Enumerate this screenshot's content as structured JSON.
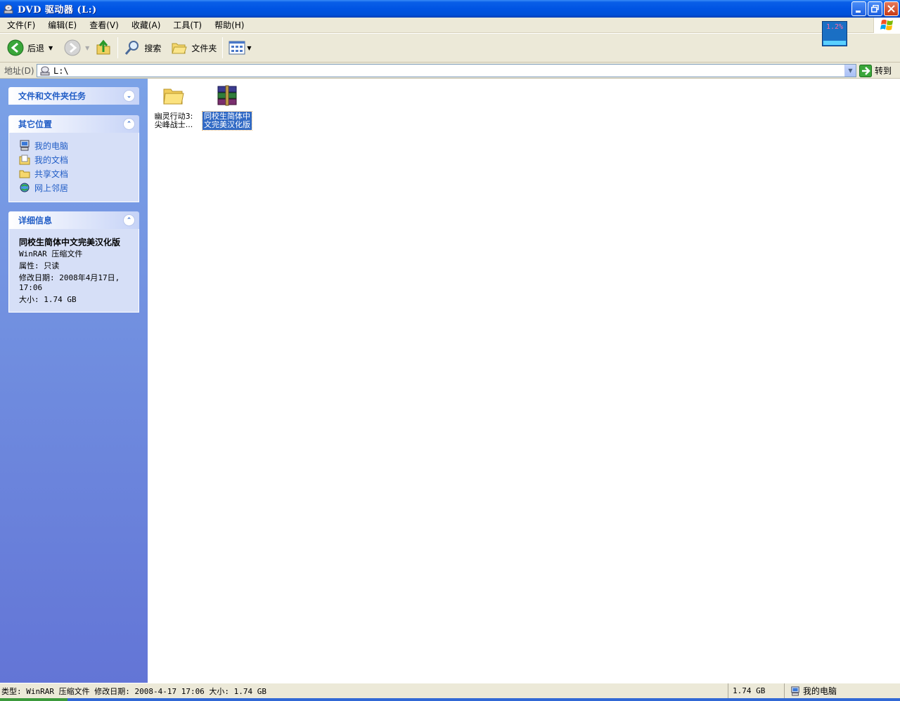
{
  "window": {
    "title": "DVD 驱动器 (L:)",
    "icons": {
      "app": "dvd-drive-icon"
    }
  },
  "menu": {
    "items": [
      {
        "label": "文件(F)"
      },
      {
        "label": "编辑(E)"
      },
      {
        "label": "查看(V)"
      },
      {
        "label": "收藏(A)"
      },
      {
        "label": "工具(T)"
      },
      {
        "label": "帮助(H)"
      }
    ],
    "cpu_widget": "1.2%"
  },
  "toolbar": {
    "back_label": "后退",
    "search_label": "搜索",
    "folders_label": "文件夹"
  },
  "address": {
    "label": "地址(D)",
    "value": "L:\\",
    "go_label": "转到"
  },
  "sidebar": {
    "tasks_title": "文件和文件夹任务",
    "places_title": "其它位置",
    "places": [
      {
        "label": "我的电脑",
        "icon": "my-computer-icon"
      },
      {
        "label": "我的文档",
        "icon": "my-documents-icon"
      },
      {
        "label": "共享文档",
        "icon": "shared-documents-icon"
      },
      {
        "label": "网上邻居",
        "icon": "network-places-icon"
      }
    ],
    "details_title": "详细信息",
    "details": {
      "name": "同校生简体中文完美汉化版",
      "type": "WinRAR 压缩文件",
      "attributes": "属性: 只读",
      "modified": "修改日期: 2008年4月17日, 17:06",
      "size": "大小: 1.74 GB"
    }
  },
  "files": [
    {
      "name": "幽灵行动3: 尖峰战士...",
      "icon": "folder-icon",
      "selected": false
    },
    {
      "name": "同校生简体中文完美汉化版",
      "icon": "winrar-archive-icon",
      "selected": true
    }
  ],
  "status": {
    "main": "类型: WinRAR 压缩文件 修改日期: 2008-4-17 17:06 大小: 1.74 GB",
    "size": "1.74 GB",
    "zone": "我的电脑"
  },
  "colors": {
    "titlebar": "#0054e3",
    "sidebar_top": "#7ba2e7",
    "sidebar_bottom": "#6375d6",
    "link": "#215dc6",
    "selection": "#316ac5"
  }
}
